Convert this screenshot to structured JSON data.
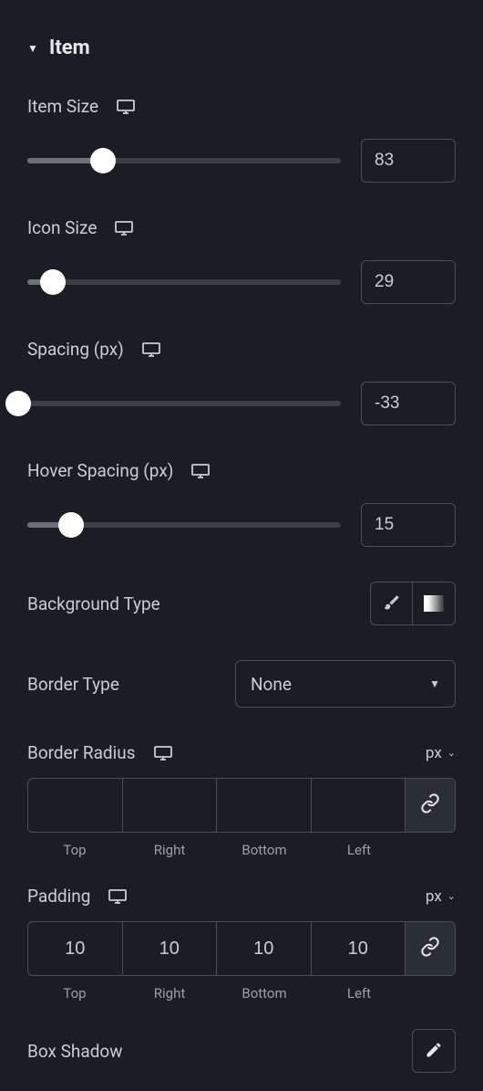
{
  "section": {
    "title": "Item"
  },
  "sliders": {
    "itemSize": {
      "label": "Item Size",
      "value": "83",
      "percent": 24
    },
    "iconSize": {
      "label": "Icon Size",
      "value": "29",
      "percent": 8
    },
    "spacing": {
      "label": "Spacing (px)",
      "value": "-33",
      "percent": 0
    },
    "hoverSpacing": {
      "label": "Hover Spacing (px)",
      "value": "15",
      "percent": 14
    }
  },
  "backgroundType": {
    "label": "Background Type"
  },
  "borderType": {
    "label": "Border Type",
    "value": "None"
  },
  "borderRadius": {
    "label": "Border Radius",
    "unit": "px",
    "top": "",
    "right": "",
    "bottom": "",
    "left": "",
    "sides": {
      "top": "Top",
      "right": "Right",
      "bottom": "Bottom",
      "left": "Left"
    }
  },
  "padding": {
    "label": "Padding",
    "unit": "px",
    "top": "10",
    "right": "10",
    "bottom": "10",
    "left": "10",
    "sides": {
      "top": "Top",
      "right": "Right",
      "bottom": "Bottom",
      "left": "Left"
    }
  },
  "boxShadow": {
    "label": "Box Shadow"
  }
}
